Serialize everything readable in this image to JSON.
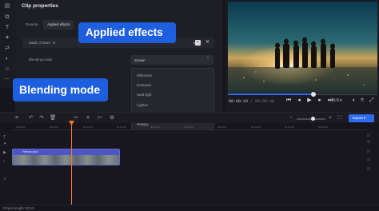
{
  "panel": {
    "title": "Clip properties",
    "tabs": [
      "General",
      "Applied effects"
    ],
    "effect_row": {
      "name": "Made of stars - 8",
      "value": "100"
    },
    "blending_label": "Blending mode",
    "blending_value": "Screen"
  },
  "dropdown": {
    "options": [
      "Difference",
      "Exclusion",
      "Hard light",
      "Lighten",
      "Linear dodge",
      "Multiply",
      "Normal",
      "Overlay",
      "Screen",
      "Soft light"
    ],
    "selected": "Screen"
  },
  "callouts": {
    "applied_effects": "Applied effects",
    "blending_mode": "Blending mode"
  },
  "preview": {
    "timecode_current": "00:00:10",
    "timecode_total": "/ 00:00:30",
    "ratio": "16:9",
    "progress_fraction": 0.56
  },
  "timeline": {
    "export_label": "Export",
    "clip_name": "Friends.mp4",
    "ruler": [
      "00:00:00",
      "00:00:05",
      "00:00:10",
      "00:00:15",
      "00:00:20",
      "00:00:25",
      "00:00:30",
      "00:00:35",
      "00:00:40",
      "00:00:45"
    ]
  },
  "footer": {
    "project_length": "Project length: 00:10"
  },
  "colors": {
    "accent": "#2d6cf2",
    "playhead": "#f57a2b",
    "clip": "#4b55c4"
  }
}
